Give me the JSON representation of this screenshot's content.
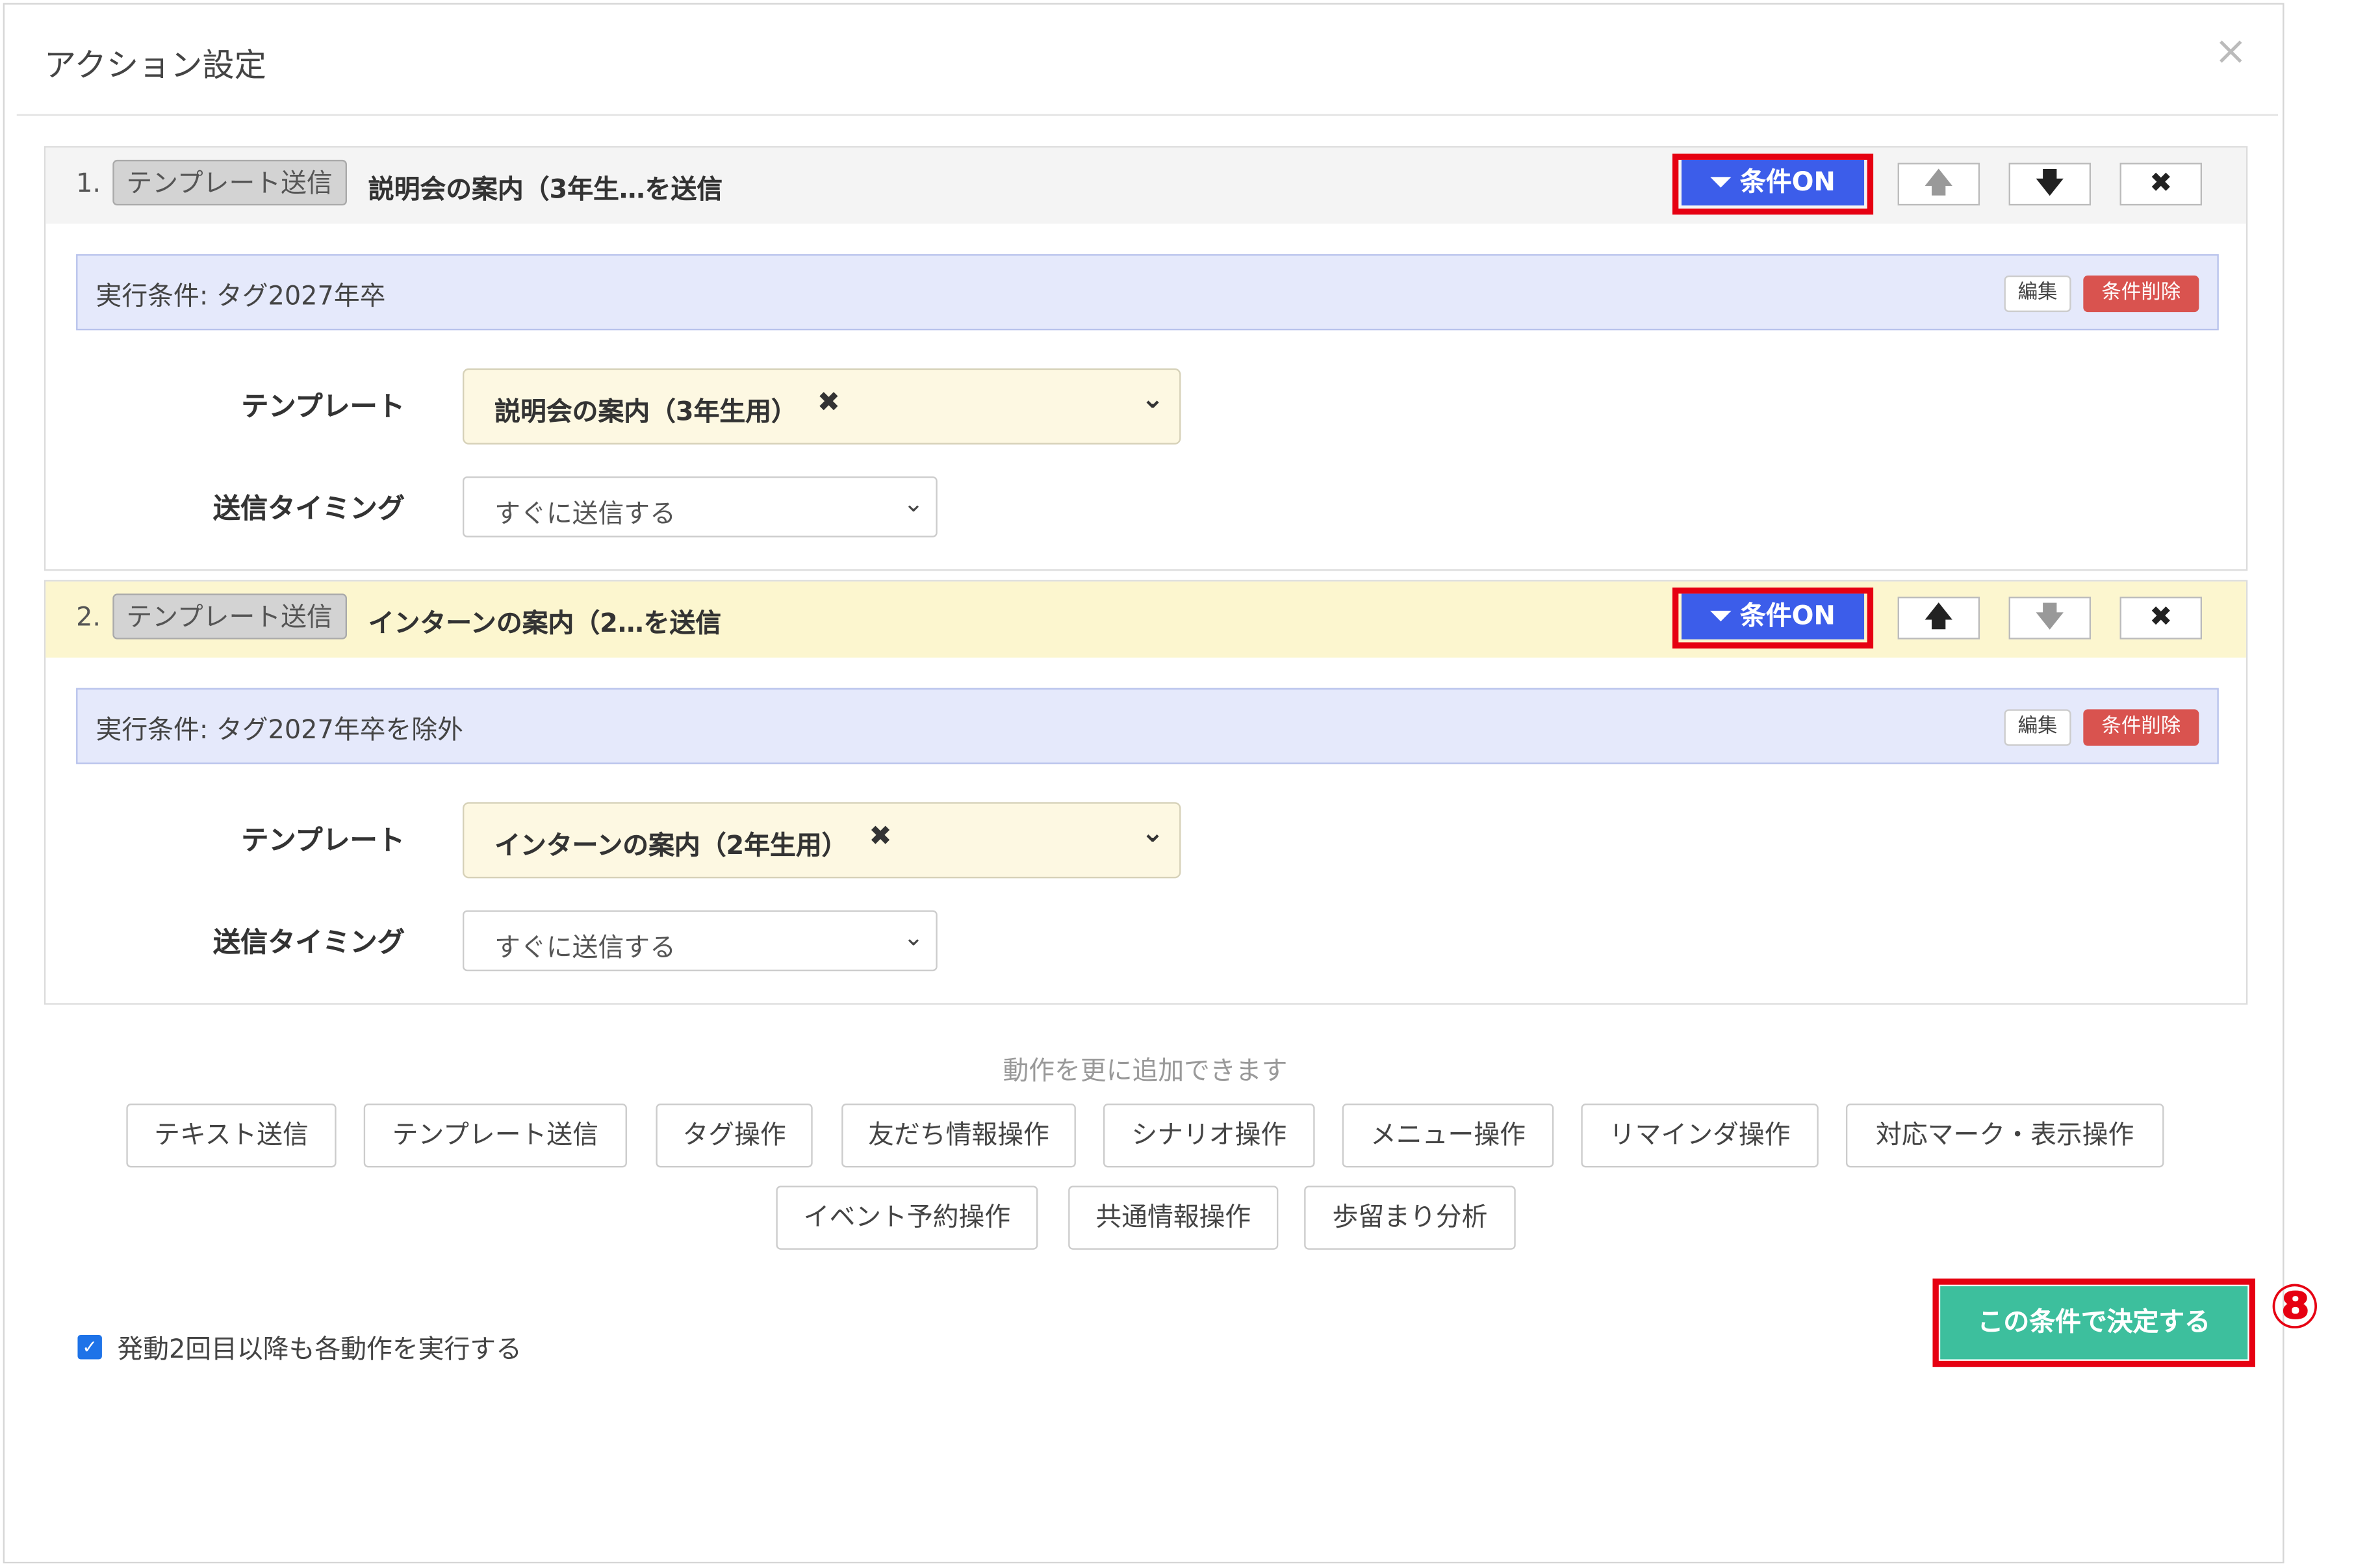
{
  "modal": {
    "title": "アクション設定",
    "close_icon": "×"
  },
  "actions": [
    {
      "index": "1.",
      "type_label": "テンプレート送信",
      "title": "説明会の案内（3年生…を送信",
      "condition_button": "条件ON",
      "up_icon": "🡅",
      "down_icon": "🡇",
      "remove_icon": "✖",
      "condition_text": "実行条件: タグ2027年卒",
      "edit_label": "編集",
      "delete_label": "条件削除",
      "template_label": "テンプレート",
      "template_value": "説明会の案内（3年生用）",
      "template_clear": "✖",
      "timing_label": "送信タイミング",
      "timing_value": "すぐに送信する"
    },
    {
      "index": "2.",
      "type_label": "テンプレート送信",
      "title": "インターンの案内（2…を送信",
      "condition_button": "条件ON",
      "up_icon": "🡅",
      "down_icon": "🡇",
      "remove_icon": "✖",
      "condition_text": "実行条件: タグ2027年卒を除外",
      "edit_label": "編集",
      "delete_label": "条件削除",
      "template_label": "テンプレート",
      "template_value": "インターンの案内（2年生用）",
      "template_clear": "✖",
      "timing_label": "送信タイミング",
      "timing_value": "すぐに送信する"
    }
  ],
  "add_hint": "動作を更に追加できます",
  "add_actions": [
    "テキスト送信",
    "テンプレート送信",
    "タグ操作",
    "友だち情報操作",
    "シナリオ操作",
    "メニュー操作",
    "リマインダ操作",
    "対応マーク・表示操作",
    "イベント予約操作",
    "共通情報操作",
    "歩留まり分析"
  ],
  "repeat_checkbox": {
    "checked": true,
    "label": "発動2回目以降も各動作を実行する"
  },
  "confirm_button": "この条件で決定する",
  "step_marker": "⑧",
  "colors": {
    "accent_blue": "#3c5dea",
    "confirm_green": "#3dbf9d",
    "highlight_red": "#e60012",
    "danger": "#d9534f"
  }
}
